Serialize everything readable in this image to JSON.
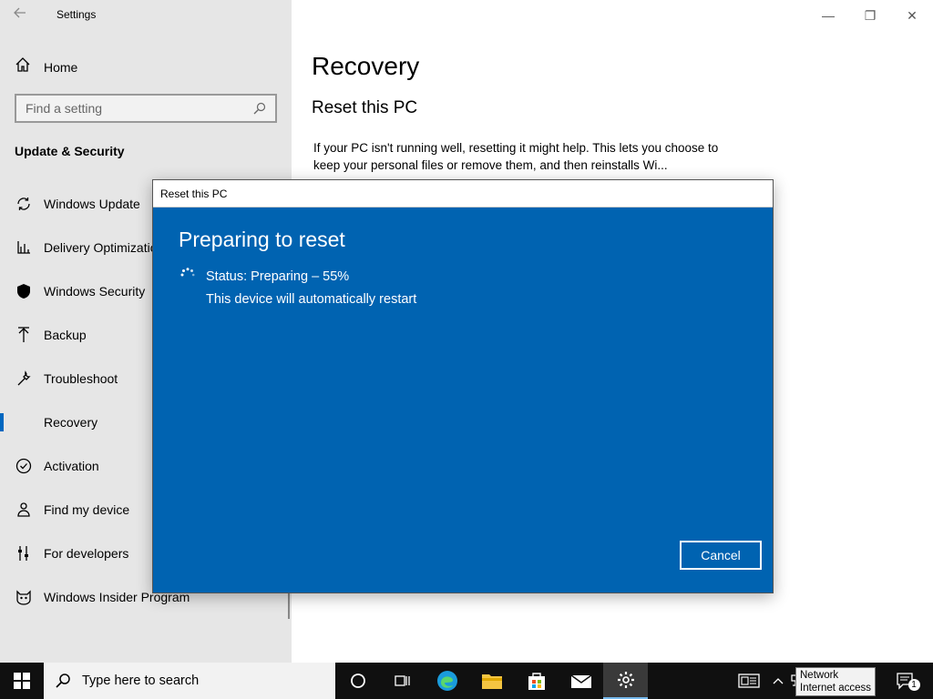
{
  "window": {
    "app_title": "Settings",
    "back_icon": "arrow-left-icon",
    "minimize": "—",
    "maximize": "❐",
    "close": "✕"
  },
  "sidebar": {
    "home_label": "Home",
    "search_placeholder": "Find a setting",
    "section_title": "Update & Security",
    "items": [
      {
        "label": "Windows Update",
        "icon": "sync-icon"
      },
      {
        "label": "Delivery Optimization",
        "icon": "delivery-icon"
      },
      {
        "label": "Windows Security",
        "icon": "shield-icon"
      },
      {
        "label": "Backup",
        "icon": "upload-arrow-icon"
      },
      {
        "label": "Troubleshoot",
        "icon": "wrench-icon"
      },
      {
        "label": "Recovery",
        "icon": "recovery-icon",
        "active": true
      },
      {
        "label": "Activation",
        "icon": "check-circle-icon"
      },
      {
        "label": "Find my device",
        "icon": "person-location-icon"
      },
      {
        "label": "For developers",
        "icon": "developer-sliders-icon"
      },
      {
        "label": "Windows Insider Program",
        "icon": "insider-cat-icon"
      }
    ]
  },
  "main": {
    "title": "Recovery",
    "subtitle": "Reset this PC",
    "description": "If your PC isn't running well, resetting it might help. This lets you choose to keep your personal files or remove them, and then reinstalls Wi..."
  },
  "dialog": {
    "title": "Reset this PC",
    "heading": "Preparing to reset",
    "status": "Status: Preparing – 55%",
    "progress_percent": 55,
    "restart_note": "This device will automatically restart",
    "cancel_label": "Cancel",
    "background_color": "#0063b1"
  },
  "taskbar": {
    "search_placeholder": "Type here to search",
    "tooltip_line1": "Network",
    "tooltip_line2": "Internet access",
    "notification_count": "1"
  }
}
